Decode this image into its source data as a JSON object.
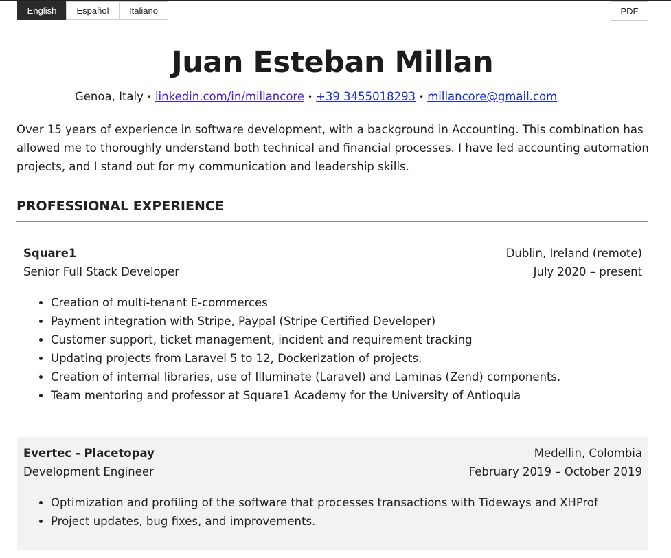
{
  "languages": [
    {
      "label": "English",
      "active": true
    },
    {
      "label": "Español",
      "active": false
    },
    {
      "label": "Italiano",
      "active": false
    }
  ],
  "pdf_label": "PDF",
  "header": {
    "name": "Juan Esteban Millan",
    "location": "Genoa, Italy",
    "linkedin": "linkedin.com/in/millancore",
    "phone": "+39 3455018293",
    "email": "millancore@gmail.com",
    "separator": "•"
  },
  "summary": "Over 15 years of experience in software development, with a background in Accounting. This combination has allowed me to thoroughly understand both technical and financial processes. I have led accounting automation projects, and I stand out for my communication and leadership skills.",
  "experience": {
    "title": "PROFESSIONAL EXPERIENCE",
    "jobs": [
      {
        "company": "Square1",
        "location": "Dublin, Ireland (remote)",
        "role": "Senior Full Stack Developer",
        "dates": "July 2020 – present",
        "bullets": [
          "Creation of multi-tenant E-commerces",
          "Payment integration with Stripe, Paypal (Stripe Certified Developer)",
          "Customer support, ticket management, incident and requirement tracking",
          "Updating projects from Laravel 5 to 12, Dockerization of projects.",
          "Creation of internal libraries, use of Illuminate (Laravel) and Laminas (Zend) components.",
          "Team mentoring and professor at Square1 Academy for the University of Antioquia"
        ]
      },
      {
        "company": "Evertec - Placetopay",
        "location": "Medellin, Colombia",
        "role": "Development Engineer",
        "dates": "February 2019 – October 2019",
        "bullets": [
          "Optimization and profiling of the software that processes transactions with Tideways and XHProf",
          "Project updates, bug fixes, and improvements."
        ]
      }
    ]
  }
}
